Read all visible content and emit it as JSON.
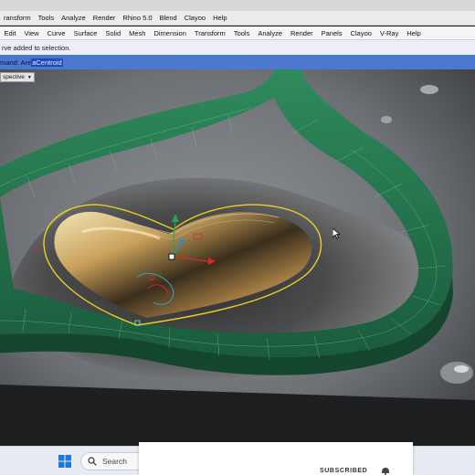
{
  "title_menu": [
    "ransform",
    "Tools",
    "Analyze",
    "Render",
    "Rhino 5.0",
    "Blend",
    "Clayoo",
    "Help"
  ],
  "main_menu": [
    "Edit",
    "View",
    "Curve",
    "Surface",
    "Solid",
    "Mesh",
    "Dimension",
    "Transform",
    "Tools",
    "Analyze",
    "Render",
    "Panels",
    "Clayoo",
    "V-Ray",
    "Help"
  ],
  "history_text": "rve added to selection.",
  "command": {
    "prefix": "mand: Are",
    "selected": "aCentroid"
  },
  "viewport": {
    "label": "spective",
    "dropdown_glyph": "▼"
  },
  "taskbar": {
    "search_placeholder": "Search"
  },
  "overlay": {
    "subscribe_text": "SUBSCRIBED"
  },
  "colors": {
    "accent_blue": "#4d78cf",
    "selection_blue": "#1f49b8",
    "model_green": "#1f6b45",
    "selection_yellow": "#f0d21c"
  }
}
